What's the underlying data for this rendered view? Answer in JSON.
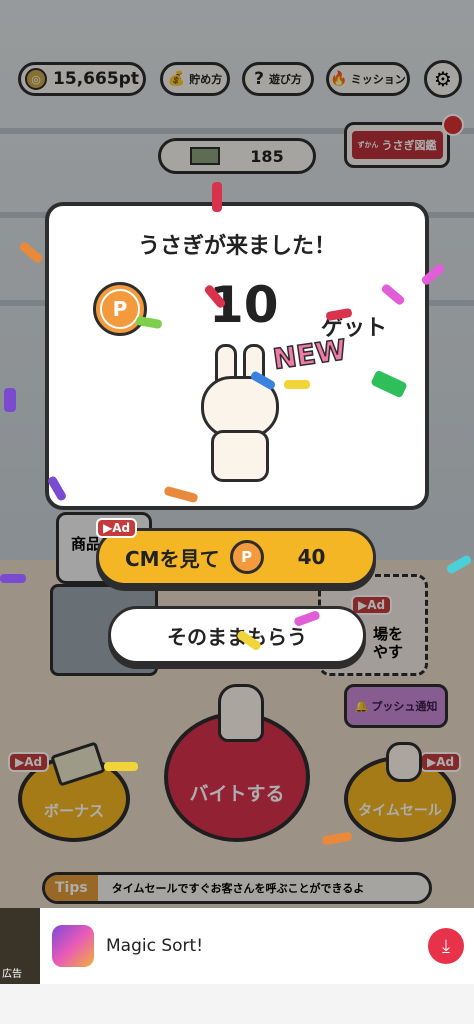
{
  "header": {
    "points": "15,665pt",
    "savings_label": "貯め方",
    "howto_label": "遊び方",
    "mission_label": "ミッション",
    "money_count": "185",
    "encyclopedia_label": "うさぎ図鑑",
    "encyclopedia_tag": "ずかん"
  },
  "modal": {
    "title": "うさぎが来ました！",
    "reward_amount": "10",
    "reward_suffix": "ゲット",
    "new_badge": "NEW",
    "p_symbol": "P"
  },
  "buttons": {
    "watch_cm_label": "CMを見て",
    "watch_cm_amount": "40",
    "ad_tag": "Ad",
    "receive_label": "そのままもらう"
  },
  "background": {
    "product_label": "商品",
    "expand_label": "場を\nやす",
    "push_label": "プッシュ通知",
    "bonus_label": "ボーナス",
    "work_label": "バイトする",
    "timesale_label": "タイムセール"
  },
  "tips": {
    "tag": "Tips",
    "text": "タイムセールですぐお客さんを呼ぶことができるよ"
  },
  "ad_banner": {
    "title": "Magic Sort!",
    "ad_label": "広告"
  },
  "colors": {
    "accent_yellow": "#f4b624",
    "coin_orange": "#f39a3c",
    "work_red": "#d8324d",
    "ad_red": "#c53b3b",
    "new_pink": "#f07aa8"
  }
}
